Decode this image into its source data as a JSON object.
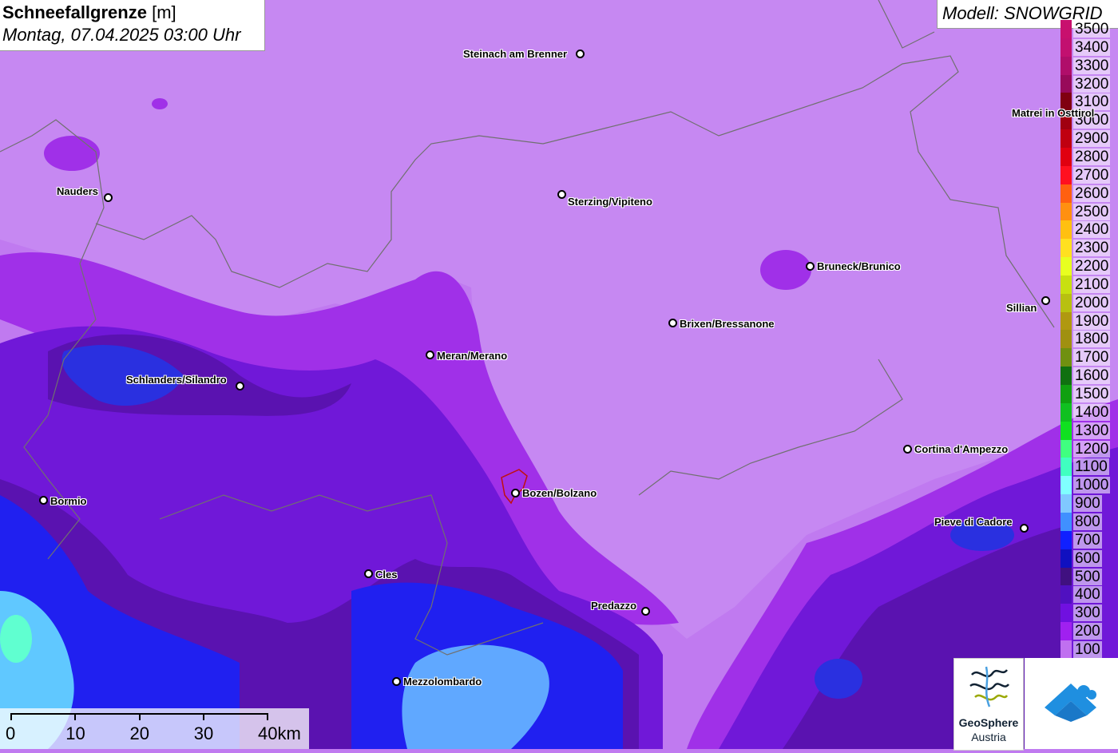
{
  "header": {
    "title_bold": "Schneefallgrenze",
    "title_unit": "[m]",
    "datetime": "Montag, 07.04.2025 03:00 Uhr",
    "model": "Modell: SNOWGRID"
  },
  "legend": [
    {
      "label": "3500",
      "color": "#c8106e"
    },
    {
      "label": "3400",
      "color": "#c21070"
    },
    {
      "label": "3300",
      "color": "#b00e6a"
    },
    {
      "label": "3200",
      "color": "#980a5a"
    },
    {
      "label": "3100",
      "color": "#800010"
    },
    {
      "label": "3000",
      "color": "#a00010"
    },
    {
      "label": "2900",
      "color": "#c00010"
    },
    {
      "label": "2800",
      "color": "#e00010"
    },
    {
      "label": "2700",
      "color": "#ff1020"
    },
    {
      "label": "2600",
      "color": "#ff6010"
    },
    {
      "label": "2500",
      "color": "#ff9010"
    },
    {
      "label": "2400",
      "color": "#ffc010"
    },
    {
      "label": "2300",
      "color": "#ffe020"
    },
    {
      "label": "2200",
      "color": "#e8ff20"
    },
    {
      "label": "2100",
      "color": "#c8e010"
    },
    {
      "label": "2000",
      "color": "#b8c010"
    },
    {
      "label": "1900",
      "color": "#b09810"
    },
    {
      "label": "1800",
      "color": "#a09010"
    },
    {
      "label": "1700",
      "color": "#709010"
    },
    {
      "label": "1600",
      "color": "#107010"
    },
    {
      "label": "1500",
      "color": "#10a010"
    },
    {
      "label": "1400",
      "color": "#10c020"
    },
    {
      "label": "1300",
      "color": "#10e020"
    },
    {
      "label": "1200",
      "color": "#40ff80"
    },
    {
      "label": "1100",
      "color": "#40ffc0"
    },
    {
      "label": "1000",
      "color": "#80ffff"
    },
    {
      "label": "900",
      "color": "#80c8ff"
    },
    {
      "label": "800",
      "color": "#4090ff"
    },
    {
      "label": "700",
      "color": "#1020ff"
    },
    {
      "label": "600",
      "color": "#1010c0"
    },
    {
      "label": "500",
      "color": "#401080"
    },
    {
      "label": "400",
      "color": "#5010c0"
    },
    {
      "label": "300",
      "color": "#7010e0"
    },
    {
      "label": "200",
      "color": "#a020f0"
    },
    {
      "label": "100",
      "color": "#c070f0"
    }
  ],
  "cities": [
    {
      "name": "Steinach am Brenner"
    },
    {
      "name": "Nauders"
    },
    {
      "name": "Sterzing/Vipiteno"
    },
    {
      "name": "Matrei in Osttirol"
    },
    {
      "name": "Bruneck/Brunico"
    },
    {
      "name": "Sillian"
    },
    {
      "name": "Brixen/Bressanone"
    },
    {
      "name": "Meran/Merano"
    },
    {
      "name": "Schlanders/Silandro"
    },
    {
      "name": "Cortina d'Ampezzo"
    },
    {
      "name": "Bormio"
    },
    {
      "name": "Bozen/Bolzano"
    },
    {
      "name": "Pieve di Cadore"
    },
    {
      "name": "Cles"
    },
    {
      "name": "Predazzo"
    },
    {
      "name": "Mezzolombardo"
    }
  ],
  "scale": {
    "labels": [
      "0",
      "10",
      "20",
      "30",
      "40km"
    ]
  },
  "logos": {
    "geosphere_line1": "GeoSphere",
    "geosphere_line2": "Austria"
  },
  "colors": {
    "background": "#c07af0",
    "lilac": "#c688f2",
    "magenta": "#a030e8",
    "violet": "#7018d8",
    "dark_violet": "#5a12b0",
    "blue": "#2020f0",
    "light_blue": "#60a8ff",
    "cyan": "#60ffd0"
  }
}
